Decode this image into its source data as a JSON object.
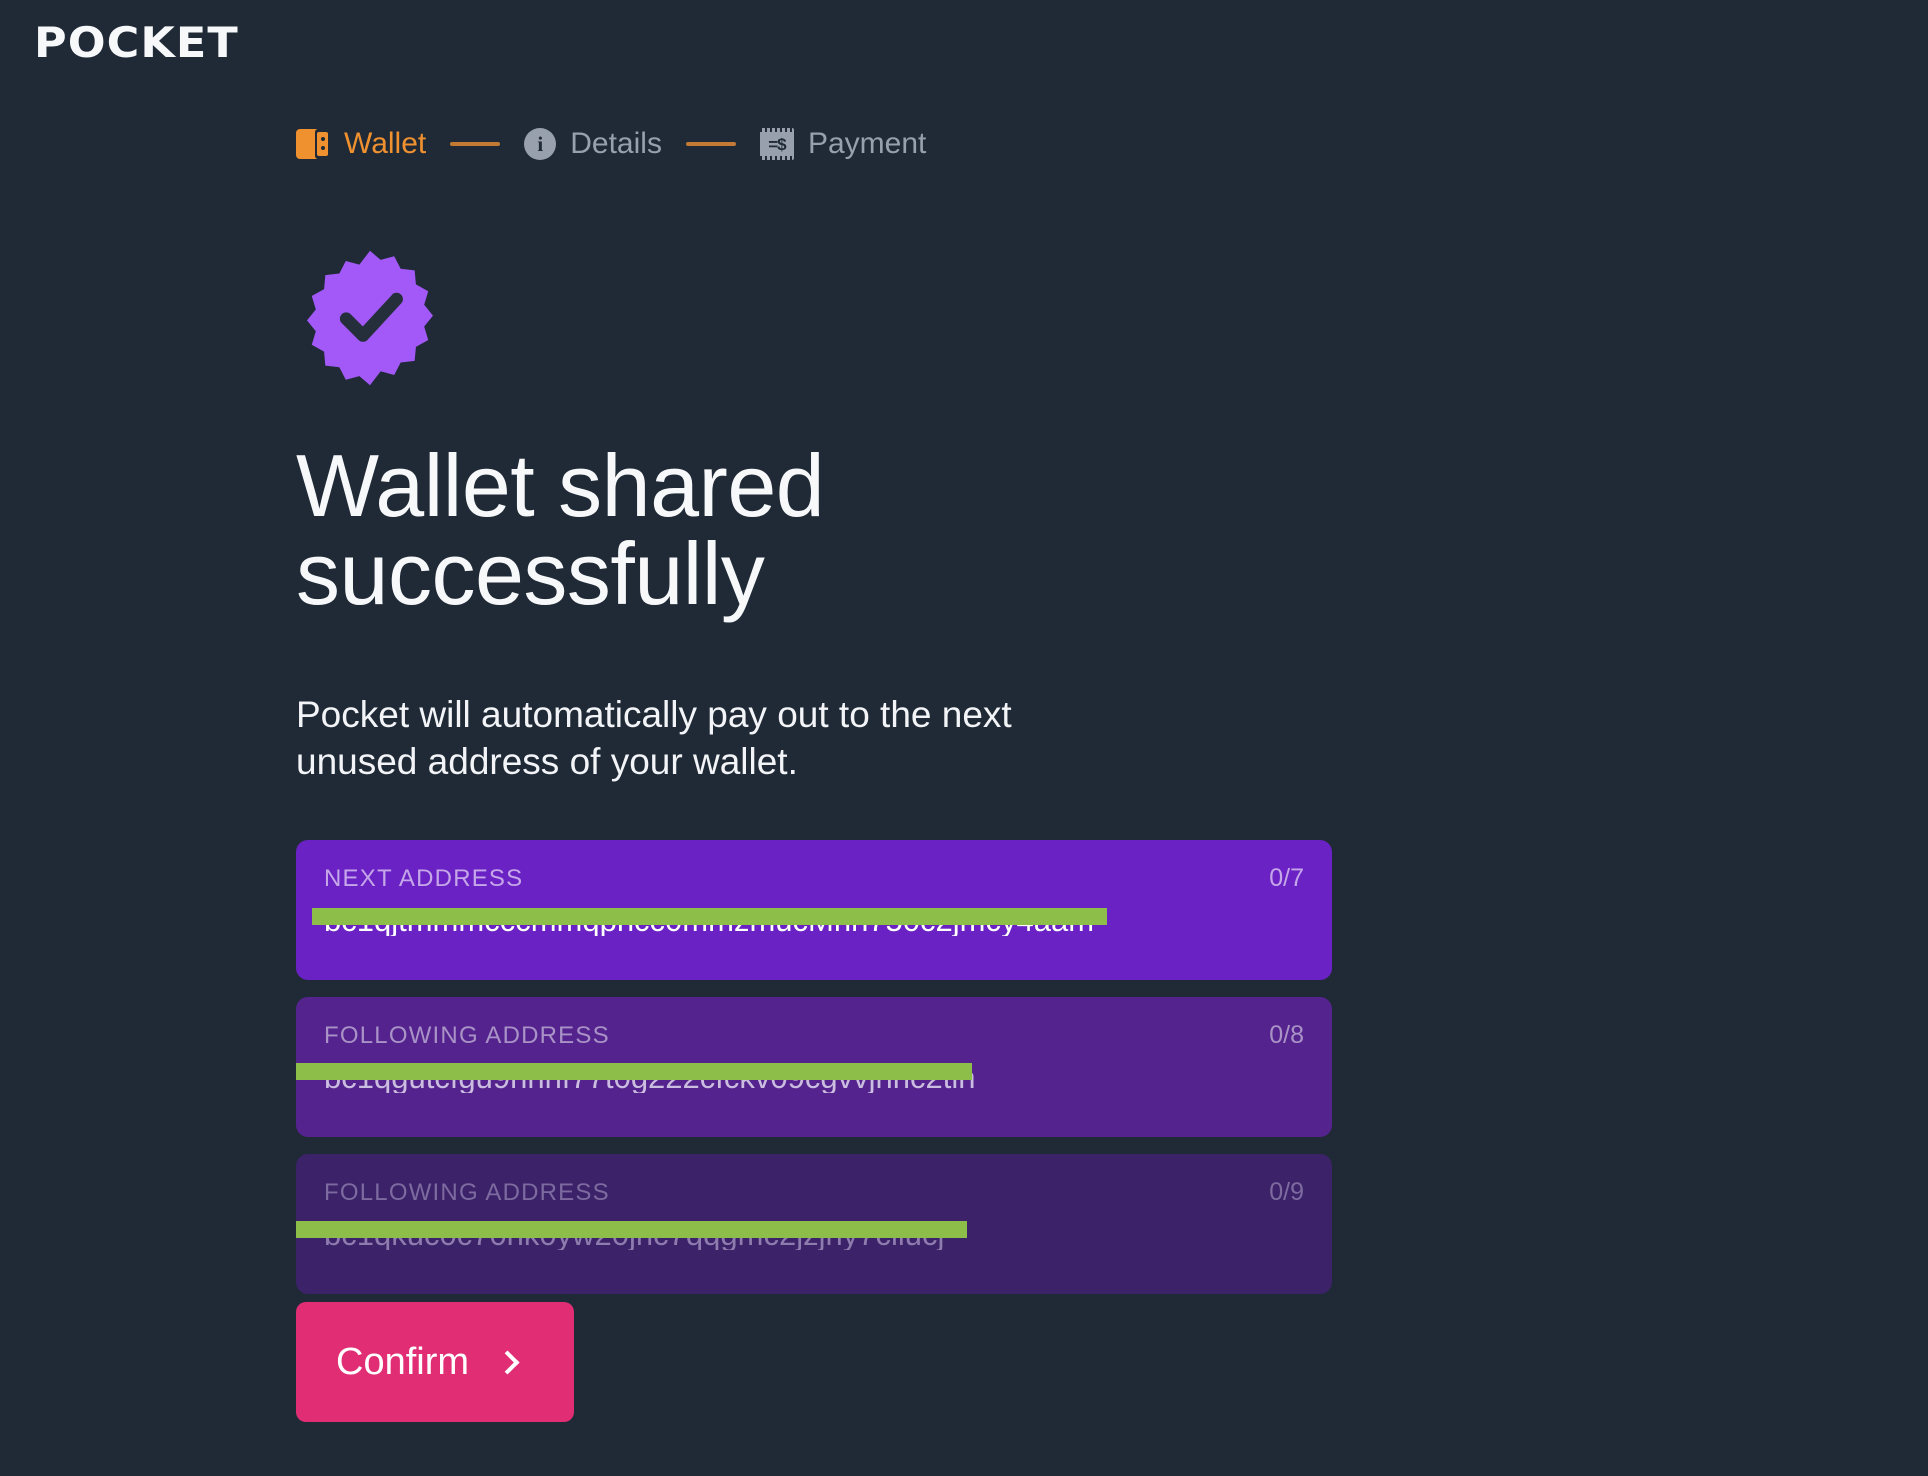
{
  "brand": {
    "logo_text": "POCKET"
  },
  "stepper": {
    "steps": [
      {
        "label": "Wallet",
        "icon": "wallet-icon",
        "state": "active"
      },
      {
        "label": "Details",
        "icon": "info-icon",
        "state": "inactive"
      },
      {
        "label": "Payment",
        "icon": "receipt-icon",
        "state": "inactive"
      }
    ]
  },
  "status": {
    "icon": "check-badge-icon",
    "badge_color": "#a259f7",
    "check_color": "#252f3c",
    "heading": "Wallet shared successfully",
    "body": "Pocket will automatically pay out to the next unused address of your wallet."
  },
  "addresses": [
    {
      "label": "NEXT ADDRESS",
      "count": "0/7",
      "value": "bc1qjtmmmcccmmqphcc0mmzmucMnn750c2jmcy4aam",
      "redacted": true
    },
    {
      "label": "FOLLOWING ADDRESS",
      "count": "0/8",
      "value": "bc1qgutcfgu9hhnf77t0g222cfckv09cgvvjnhc2tlh",
      "redacted": true
    },
    {
      "label": "FOLLOWING ADDRESS",
      "count": "0/9",
      "value": "bc1qkuc0c70hk0yw20jnc7qqgmc2jzjny7cllucj",
      "redacted": true
    }
  ],
  "actions": {
    "confirm_label": "Confirm",
    "confirm_icon": "chevron-right-icon",
    "confirm_color": "#e02d74"
  },
  "theme": {
    "background": "#202a36",
    "accent_orange": "#f0912f",
    "card_tier1": "#6a22c4",
    "card_tier2": "#55238e",
    "card_tier3": "#3c2268",
    "redaction_green": "#8cbe49"
  }
}
